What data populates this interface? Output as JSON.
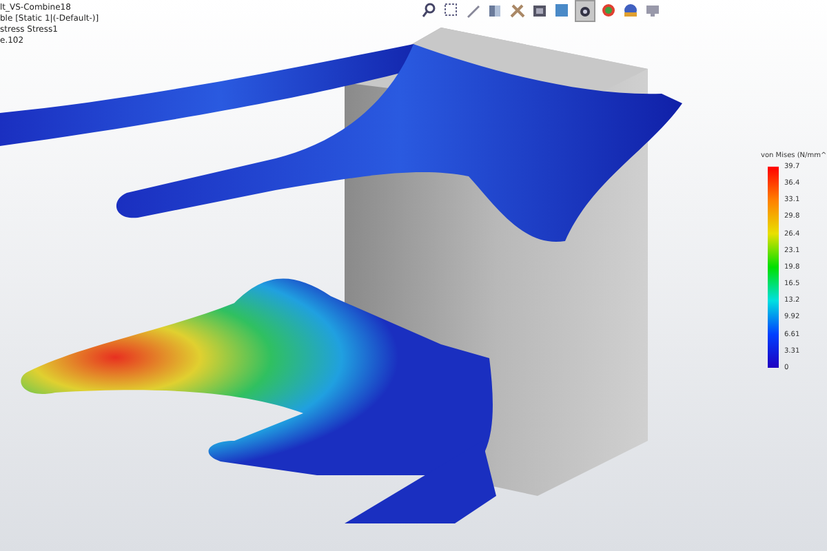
{
  "study_info": [
    "lt_VS-Combine18",
    "ble [Static 1|(-Default-)]",
    "stress Stress1",
    "e.102"
  ],
  "toolbar": [
    {
      "pressed": false
    },
    {
      "pressed": false
    },
    {
      "pressed": false
    },
    {
      "pressed": false
    },
    {
      "pressed": false
    },
    {
      "pressed": false
    },
    {
      "pressed": false
    },
    {
      "pressed": true
    },
    {
      "pressed": false
    },
    {
      "pressed": false
    },
    {
      "pressed": false
    }
  ],
  "legend": {
    "title": "von Mises (N/mm^",
    "labels": [
      "39.7",
      "36.4",
      "33.1",
      "29.8",
      "26.4",
      "23.1",
      "19.8",
      "16.5",
      "13.2",
      "9.92",
      "6.61",
      "3.31",
      "0"
    ]
  }
}
